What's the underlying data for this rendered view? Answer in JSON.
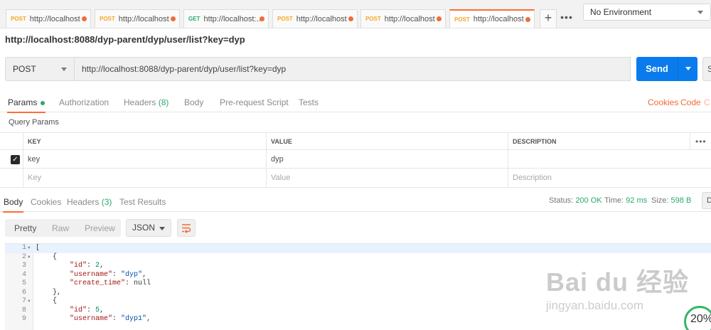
{
  "tabs": [
    {
      "method": "POST",
      "label": "http://localhost",
      "active": false
    },
    {
      "method": "POST",
      "label": "http://localhost",
      "active": false
    },
    {
      "method": "GET",
      "label": "http://localhost:...",
      "active": false
    },
    {
      "method": "POST",
      "label": "http://localhost",
      "active": false
    },
    {
      "method": "POST",
      "label": "http://localhost",
      "active": false
    },
    {
      "method": "POST",
      "label": "http://localhost",
      "active": true
    }
  ],
  "tabs_extra": {
    "add": "+",
    "more": "•••"
  },
  "environment": "No Environment",
  "request": {
    "title": "http://localhost:8088/dyp-parent/dyp/user/list?key=dyp",
    "method": "POST",
    "url": "http://localhost:8088/dyp-parent/dyp/user/list?key=dyp",
    "send_label": "Send",
    "save_label": "S"
  },
  "request_tabs": {
    "params": "Params",
    "authorization": "Authorization",
    "headers": "Headers",
    "headers_count": "(8)",
    "body": "Body",
    "prerequest": "Pre-request Script",
    "tests": "Tests",
    "cookies": "Cookies",
    "code": "Code",
    "extra": "C"
  },
  "query_params": {
    "title": "Query Params",
    "headers": {
      "key": "KEY",
      "value": "VALUE",
      "description": "DESCRIPTION",
      "more": "•••"
    },
    "rows": [
      {
        "checked": true,
        "key": "key",
        "value": "dyp",
        "description": ""
      }
    ],
    "placeholders": {
      "key": "Key",
      "value": "Value",
      "description": "Description"
    }
  },
  "response": {
    "tabs": {
      "body": "Body",
      "cookies": "Cookies",
      "headers": "Headers",
      "headers_count": "(3)",
      "test_results": "Test Results"
    },
    "status_label": "Status:",
    "status_value": "200 OK",
    "time_label": "Time:",
    "time_value": "92 ms",
    "size_label": "Size:",
    "size_value": "598 B",
    "download_label": "D",
    "view_modes": [
      "Pretty",
      "Raw",
      "Preview"
    ],
    "format": "JSON",
    "code_lines": [
      {
        "n": "1",
        "fold": true,
        "text": "["
      },
      {
        "n": "2",
        "fold": true,
        "text": "    {"
      },
      {
        "n": "3",
        "fold": false,
        "key": "\"id\"",
        "sep": ": ",
        "val": "2",
        "vtype": "n",
        "indent": "        "
      },
      {
        "n": "4",
        "fold": false,
        "key": "\"username\"",
        "sep": ": ",
        "val": "\"dyp\"",
        "vtype": "s",
        "indent": "        "
      },
      {
        "n": "5",
        "fold": false,
        "key": "\"create_time\"",
        "sep": ": ",
        "val": "null",
        "vtype": "p",
        "indent": "        "
      },
      {
        "n": "6",
        "fold": false,
        "text": "    },"
      },
      {
        "n": "7",
        "fold": true,
        "text": "    {"
      },
      {
        "n": "8",
        "fold": false,
        "key": "\"id\"",
        "sep": ": ",
        "val": "5",
        "vtype": "n",
        "indent": "        "
      },
      {
        "n": "9",
        "fold": false,
        "key": "\"username\"",
        "sep": ": ",
        "val": "\"dyp1\"",
        "vtype": "s",
        "indent": "        "
      }
    ]
  },
  "watermark": {
    "logo": "Bai du 经验",
    "sub": "jingyan.baidu.com",
    "badge": "20%"
  }
}
